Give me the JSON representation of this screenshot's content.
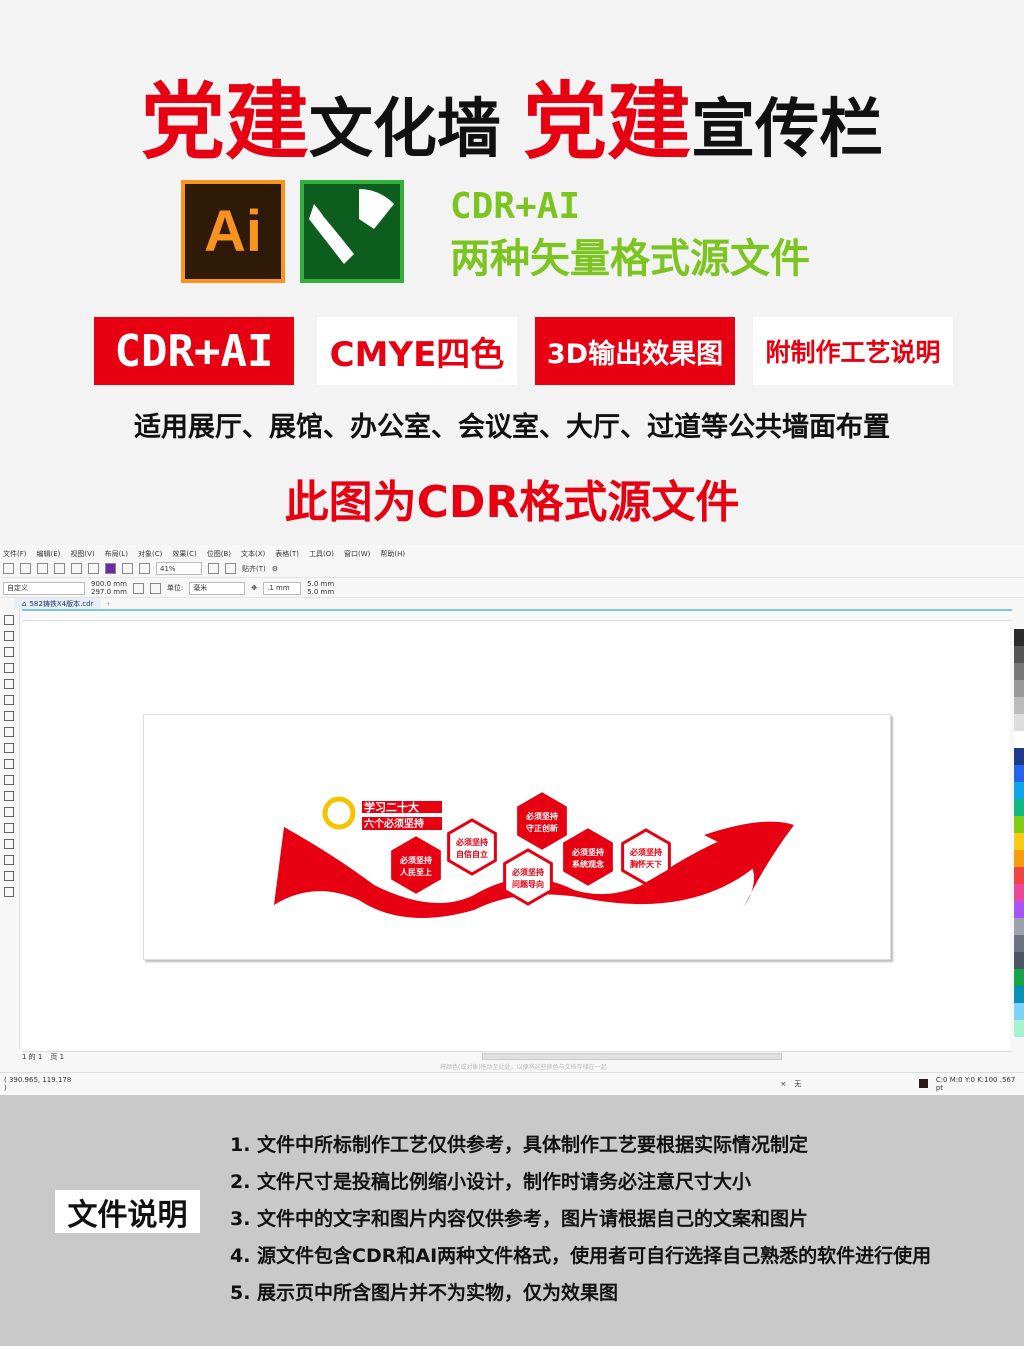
{
  "header": {
    "title_parts": [
      {
        "text": "党建",
        "red": true
      },
      {
        "text": "文化墙 ",
        "red": false
      },
      {
        "text": "党建",
        "red": true
      },
      {
        "text": "宣传栏",
        "red": false
      }
    ],
    "ai_logo": "Ai",
    "format_line1": "CDR+AI",
    "format_line2": "两种矢量格式源文件",
    "badges": [
      {
        "label": "CDR+AI",
        "style": "red"
      },
      {
        "label": "CMYE四色",
        "style": "white"
      },
      {
        "label": "3D输出效果图",
        "style": "red"
      },
      {
        "label": "附制作工艺说明",
        "style": "white"
      }
    ],
    "usage": "适用展厅、展馆、办公室、会议室、大厅、过道等公共墙面布置",
    "source_note": "此图为CDR格式源文件"
  },
  "colors": {
    "red": "#e60012",
    "green": "#7cc41f",
    "ai_orange": "#f7931e",
    "corel_green": "#35b03c"
  },
  "app": {
    "menu": [
      "文件(F)",
      "编辑(E)",
      "视图(V)",
      "布局(L)",
      "对象(C)",
      "效果(C)",
      "位图(B)",
      "文本(X)",
      "表格(T)",
      "工具(O)",
      "窗口(W)",
      "帮助(H)"
    ],
    "zoom": "41%",
    "snap": "贴齐(T)",
    "preset": "自定义",
    "width": "900.0 mm",
    "height": "297.0 mm",
    "unit_label": "单位:",
    "unit": "毫米",
    "nudge": ".1 mm",
    "dup_x": "5.0 mm",
    "dup_y": "5.0 mm",
    "doc_tab": "582铸铁X4版本.cdr",
    "page_nav": "1 的 1",
    "page_tab": "页 1",
    "hint": "将颜色(或对象)拖动至此处，以便将这些颜色与文档存储在一起",
    "coords": "( 390.965, 119.178 )",
    "fill_none": "无",
    "outline": "C:0 M:0 Y:0 K:100  .567 pt",
    "palette": [
      "#2b2b2b",
      "#555",
      "#777",
      "#999",
      "#bbb",
      "#ddd",
      "#fff",
      "#1e3a8a",
      "#2563eb",
      "#0ea5e9",
      "#10b981",
      "#84cc16",
      "#facc15",
      "#f59e0b",
      "#ef4444",
      "#ec4899",
      "#a855f7",
      "#9ca3af",
      "#6b7280",
      "#4b5563",
      "#16a34a",
      "#0891b2",
      "#7dd3fc",
      "#a7f3d0"
    ]
  },
  "artwork": {
    "title1": "学习二十大",
    "title2": "六个必须坚持",
    "hexes": [
      {
        "l1": "必须坚持",
        "l2": "人民至上",
        "filled": true
      },
      {
        "l1": "必须坚持",
        "l2": "自信自立",
        "filled": false
      },
      {
        "l1": "必须坚持",
        "l2": "守正创新",
        "filled": true
      },
      {
        "l1": "必须坚持",
        "l2": "问题导向",
        "filled": false
      },
      {
        "l1": "必须坚持",
        "l2": "系统观念",
        "filled": true
      },
      {
        "l1": "必须坚持",
        "l2": "胸怀天下",
        "filled": false
      }
    ]
  },
  "notes": {
    "heading": "文件说明",
    "items": [
      "1. 文件中所标制作工艺仅供参考，具体制作工艺要根据实际情况制定",
      "2. 文件尺寸是投稿比例缩小设计，制作时请务必注意尺寸大小",
      "3. 文件中的文字和图片内容仅供参考，图片请根据自己的文案和图片",
      "4. 源文件包含CDR和AI两种文件格式，使用者可自行选择自己熟悉的软件进行使用",
      "5. 展示页中所含图片并不为实物，仅为效果图"
    ]
  }
}
